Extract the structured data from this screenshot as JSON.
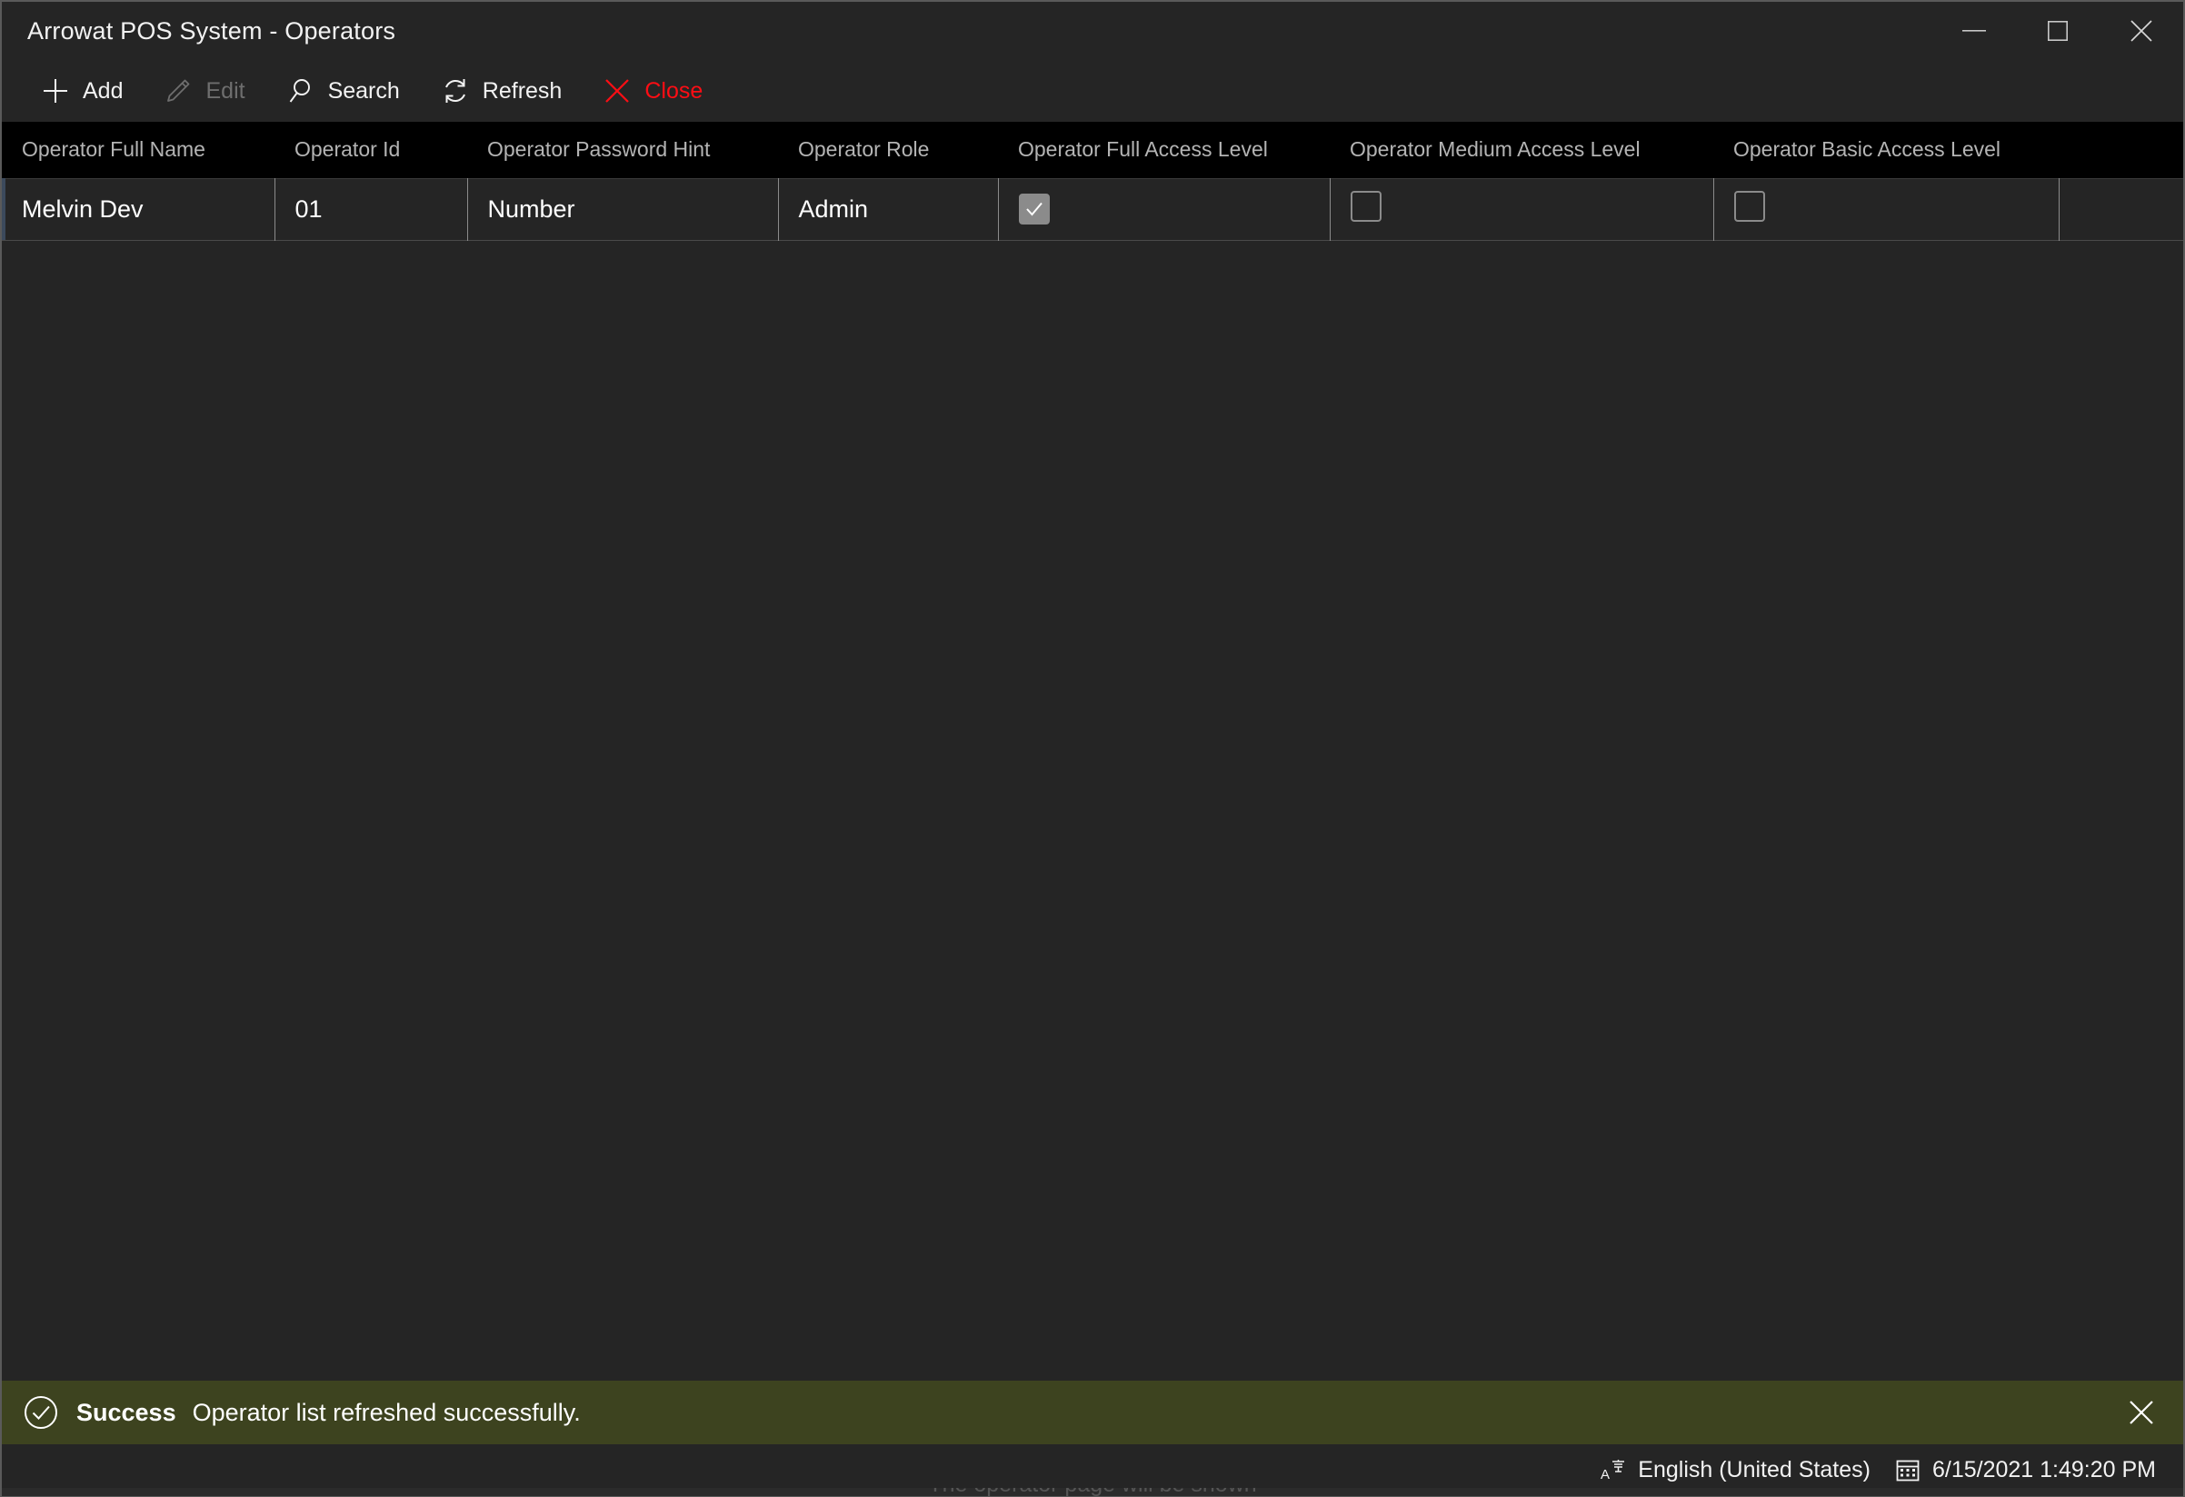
{
  "window": {
    "title": "Arrowat POS System - Operators",
    "controls": {
      "minimize": "minimize-button",
      "maximize": "maximize-button",
      "close": "close-button"
    }
  },
  "toolbar": {
    "items": [
      {
        "label": "Add",
        "icon": "plus-icon",
        "state": "enabled"
      },
      {
        "label": "Edit",
        "icon": "pencil-icon",
        "state": "disabled"
      },
      {
        "label": "Search",
        "icon": "search-icon",
        "state": "enabled"
      },
      {
        "label": "Refresh",
        "icon": "refresh-icon",
        "state": "enabled"
      },
      {
        "label": "Close",
        "icon": "x-icon",
        "state": "danger"
      }
    ]
  },
  "grid": {
    "columns": [
      "Operator Full Name",
      "Operator Id",
      "Operator Password Hint",
      "Operator Role",
      "Operator Full Access Level",
      "Operator Medium Access Level",
      "Operator Basic Access Level",
      ""
    ],
    "rows": [
      {
        "full_name": "Melvin Dev",
        "operator_id": "01",
        "password_hint": "Number",
        "role": "Admin",
        "full_access": true,
        "medium_access": false,
        "basic_access": false
      }
    ]
  },
  "notification": {
    "icon": "check-circle-icon",
    "title": "Success",
    "message": "Operator list refreshed successfully.",
    "close_icon": "close-icon",
    "background": "#3d431f"
  },
  "statusbar": {
    "language_icon": "keyboard-language-icon",
    "language": "English (United States)",
    "calendar_icon": "calendar-icon",
    "datetime": "6/15/2021 1:49:20 PM"
  },
  "clipped_hint": "The operator page will be shown",
  "colors": {
    "window_background": "#252525",
    "header_background": "#000000",
    "accent_danger": "#ff0d14",
    "disabled_text": "#6e6e6e",
    "success_background": "#3d431f"
  }
}
